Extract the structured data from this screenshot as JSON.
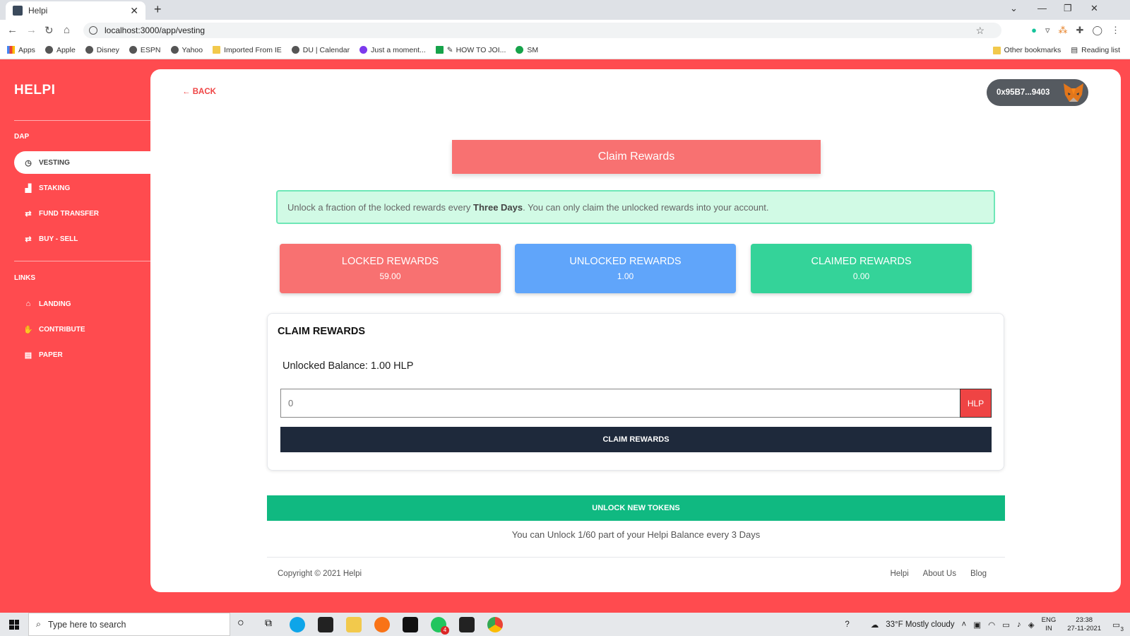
{
  "browser": {
    "tab_title": "Helpi",
    "new_tab": "+",
    "url": "localhost:3000/app/vesting",
    "bookmarks": [
      "Apps",
      "Apple",
      "Disney",
      "ESPN",
      "Yahoo",
      "Imported From IE",
      "DU | Calendar",
      "Just a moment...",
      "HOW TO JOI...",
      "SM"
    ],
    "other_bookmarks": "Other bookmarks",
    "reading_list": "Reading list"
  },
  "sidebar": {
    "brand": "HELPI",
    "sections": [
      {
        "header": "DAP",
        "items": [
          {
            "label": "VESTING",
            "icon": "clock-icon",
            "active": true
          },
          {
            "label": "STAKING",
            "icon": "staking-icon"
          },
          {
            "label": "FUND TRANSFER",
            "icon": "transfer-icon"
          },
          {
            "label": "BUY - SELL",
            "icon": "exchange-icon"
          }
        ]
      },
      {
        "header": "LINKS",
        "items": [
          {
            "label": "LANDING",
            "icon": "home-icon"
          },
          {
            "label": "CONTRIBUTE",
            "icon": "handshake-icon"
          },
          {
            "label": "PAPER",
            "icon": "document-icon"
          }
        ]
      }
    ]
  },
  "header": {
    "back_label": "BACK",
    "wallet_address": "0x95B7...9403"
  },
  "main": {
    "title": "Claim Rewards",
    "alert": {
      "prefix": "Unlock a fraction of the locked rewards every",
      "highlight": "Three Days",
      "suffix": ". You can only claim the unlocked rewards into your account."
    },
    "cards": [
      {
        "title": "LOCKED REWARDS",
        "value": "59.00",
        "color": "#f87171"
      },
      {
        "title": "UNLOCKED REWARDS",
        "value": "1.00",
        "color": "#60a5fa"
      },
      {
        "title": "CLAIMED REWARDS",
        "value": "0.00",
        "color": "#34d399"
      }
    ],
    "claim_box": {
      "title": "CLAIM REWARDS",
      "balance": "Unlocked Balance: 1.00 HLP",
      "amount_placeholder": "0",
      "unit": "HLP",
      "button": "CLAIM REWARDS"
    },
    "unlock_button": "UNLOCK NEW TOKENS",
    "unlock_note": "You can Unlock 1/60 part of your Helpi Balance every 3 Days"
  },
  "footer": {
    "copyright": "Copyright © 2021 Helpi",
    "links": [
      "Helpi",
      "About Us",
      "Blog"
    ]
  },
  "taskbar": {
    "search_placeholder": "Type here to search",
    "weather": "33°F  Mostly cloudy",
    "lang_top": "ENG",
    "lang_bottom": "IN",
    "time": "23:38",
    "date": "27-11-2021",
    "notification_count": "3",
    "whatsapp_badge": "4"
  },
  "colors": {
    "brand_red": "#ff4b4f",
    "claim_header": "#f87171",
    "dark_button": "#1e293b",
    "green_button": "#10b981"
  }
}
